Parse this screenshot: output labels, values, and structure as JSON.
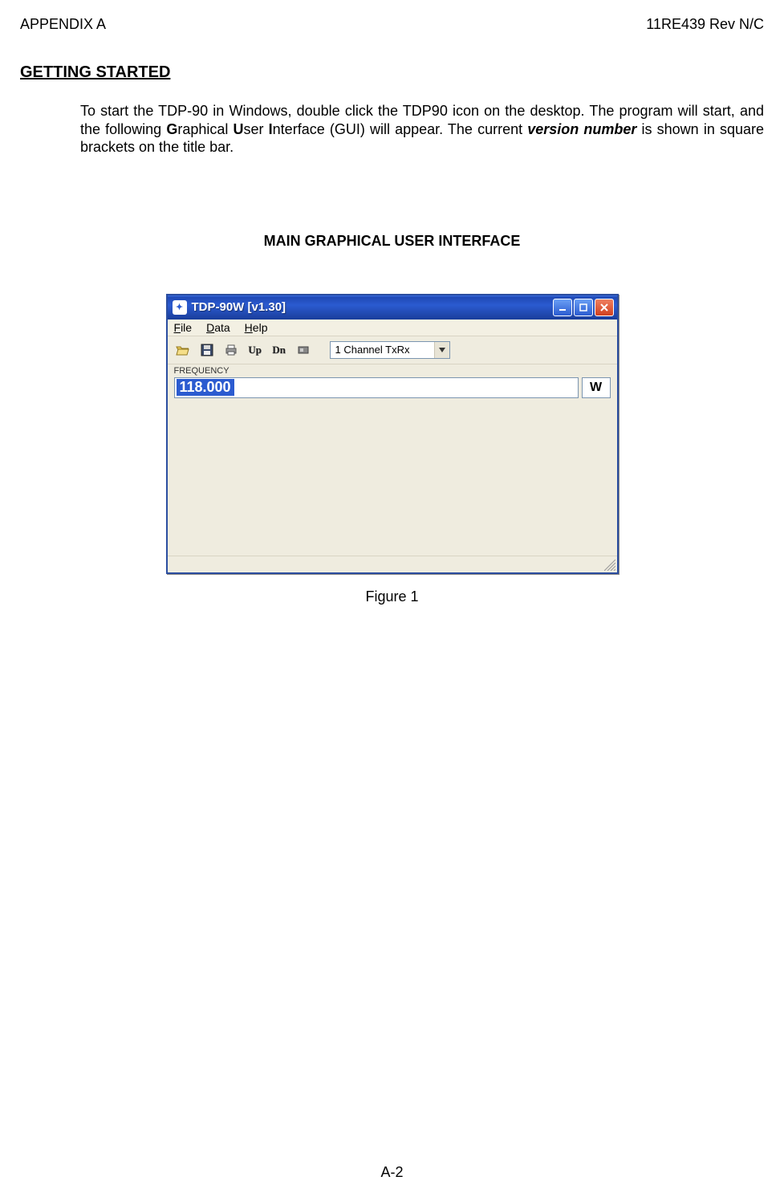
{
  "header": {
    "left": "APPENDIX A",
    "right": "11RE439 Rev N/C"
  },
  "section_heading": "GETTING STARTED",
  "body": {
    "t1": "To start the TDP-90 in Windows, double click the TDP90 icon on the desktop. The program will start, and the following ",
    "g": "G",
    "t2": "raphical ",
    "u": "U",
    "t3": "ser ",
    "i": "I",
    "t4": "nterface (GUI) will appear. The current ",
    "vn": "version number",
    "t5": " is shown in square brackets on the title bar."
  },
  "centered_heading": "MAIN GRAPHICAL USER INTERFACE",
  "figure_caption": "Figure 1",
  "page_number": "A-2",
  "window": {
    "title": "TDP-90W [v1.30]",
    "menu": {
      "file": "File",
      "data": "Data",
      "help": "Help"
    },
    "toolbar": {
      "up": "Up",
      "dn": "Dn"
    },
    "channel_selector": "1 Channel TxRx",
    "freq_label": "FREQUENCY",
    "freq_value": "118.000",
    "freq_mode": "W"
  }
}
